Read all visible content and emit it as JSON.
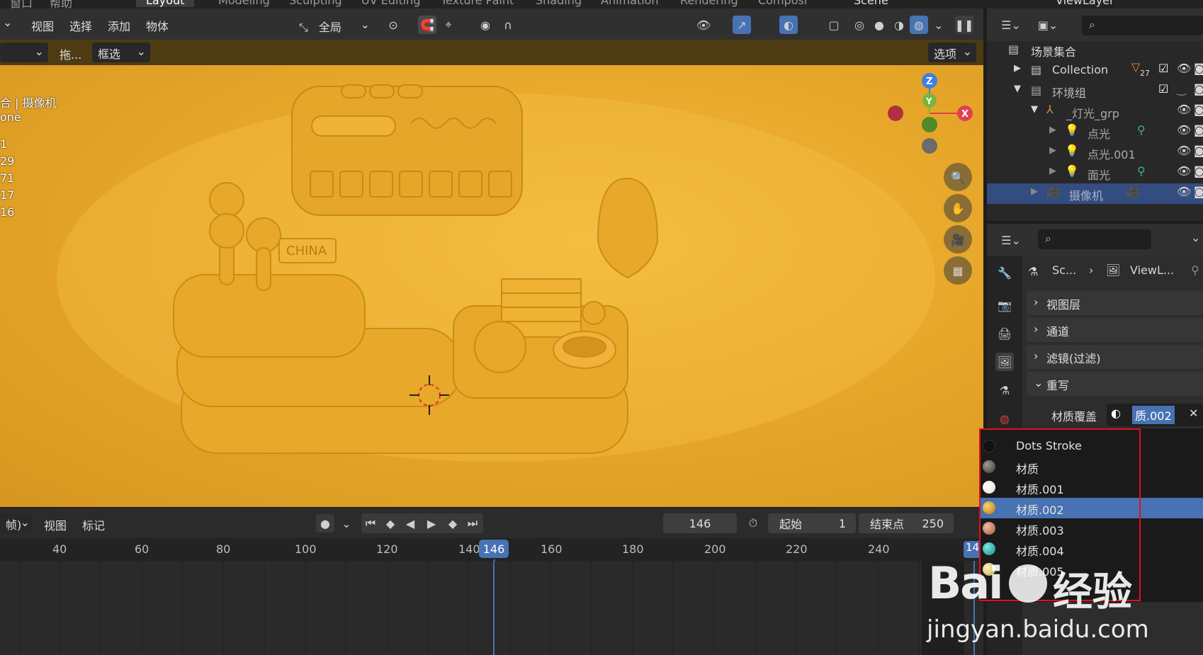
{
  "topbar": {
    "workspaces": [
      "窗口",
      "帮助",
      "Layout",
      "Modeling",
      "Sculpting",
      "UV Editing",
      "Texture Paint",
      "Shading",
      "Animation",
      "Rendering",
      "Composi"
    ],
    "scene": "Scene",
    "view_layer": "ViewLayer"
  },
  "viewport": {
    "menus": [
      "视图",
      "选择",
      "添加",
      "物体"
    ],
    "transform_orientation": "全局",
    "tool_drag_label": "拖...",
    "select_mode": "框选",
    "options_label": "选项",
    "overlay_text": [
      "合 | 摄像机",
      "one",
      "1",
      "29",
      "71",
      "17",
      "16"
    ],
    "gizmo": {
      "z": "Z",
      "y": "Y",
      "x": "X"
    },
    "model_sign": "CHINA"
  },
  "timeline": {
    "mode_label": "帧)",
    "menus": [
      "视图",
      "标记"
    ],
    "current_frame": "146",
    "start_label": "起始",
    "start_value": "1",
    "end_label": "结束点",
    "end_value": "250",
    "ruler_ticks": [
      "40",
      "60",
      "80",
      "100",
      "120",
      "140",
      "160",
      "180",
      "200",
      "220",
      "240"
    ],
    "playhead_label": "146",
    "edge_label": "14"
  },
  "outliner": {
    "rows": [
      {
        "label": "场景集合"
      },
      {
        "label": "Collection",
        "badge": "27"
      },
      {
        "label": "环境组"
      },
      {
        "label": "_灯光_grp"
      },
      {
        "label": "点光"
      },
      {
        "label": "点光.001"
      },
      {
        "label": "面光"
      },
      {
        "label": "摄像机"
      }
    ]
  },
  "properties": {
    "breadcrumb_scene": "Sc...",
    "breadcrumb_layer": "ViewL...",
    "panels": [
      "视图层",
      "通道",
      "滤镜(过滤)",
      "重写"
    ],
    "material_override_label": "材质覆盖",
    "material_override_value": "质.002"
  },
  "dropdown": {
    "items": [
      {
        "label": "Dots Stroke",
        "color": "#111111"
      },
      {
        "label": "材质",
        "color": "#5a5650"
      },
      {
        "label": "材质.001",
        "color": "#f4f1e6"
      },
      {
        "label": "材质.002",
        "color": "#e0a020"
      },
      {
        "label": "材质.003",
        "color": "#d88a70"
      },
      {
        "label": "材质.004",
        "color": "#1fb5b0"
      },
      {
        "label": "材质.005",
        "color": "#e8d890"
      }
    ],
    "selected_index": 3
  },
  "watermark": {
    "brand": "Bai",
    "brand_cn": "经验",
    "url": "jingyan.baidu.com"
  },
  "colors": {
    "accent": "#4772b3",
    "selection": "#334d80",
    "highlight_border": "#e0101e"
  }
}
